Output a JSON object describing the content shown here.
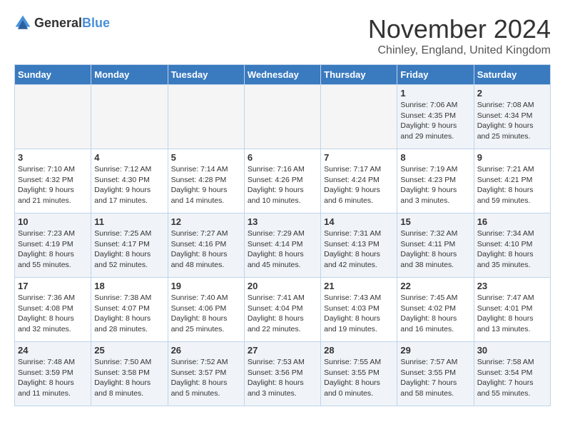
{
  "logo": {
    "text_general": "General",
    "text_blue": "Blue"
  },
  "header": {
    "month_year": "November 2024",
    "location": "Chinley, England, United Kingdom"
  },
  "weekdays": [
    "Sunday",
    "Monday",
    "Tuesday",
    "Wednesday",
    "Thursday",
    "Friday",
    "Saturday"
  ],
  "weeks": [
    [
      {
        "day": "",
        "info": "",
        "empty": true
      },
      {
        "day": "",
        "info": "",
        "empty": true
      },
      {
        "day": "",
        "info": "",
        "empty": true
      },
      {
        "day": "",
        "info": "",
        "empty": true
      },
      {
        "day": "",
        "info": "",
        "empty": true
      },
      {
        "day": "1",
        "info": "Sunrise: 7:06 AM\nSunset: 4:35 PM\nDaylight: 9 hours and 29 minutes.",
        "empty": false
      },
      {
        "day": "2",
        "info": "Sunrise: 7:08 AM\nSunset: 4:34 PM\nDaylight: 9 hours and 25 minutes.",
        "empty": false
      }
    ],
    [
      {
        "day": "3",
        "info": "Sunrise: 7:10 AM\nSunset: 4:32 PM\nDaylight: 9 hours and 21 minutes.",
        "empty": false
      },
      {
        "day": "4",
        "info": "Sunrise: 7:12 AM\nSunset: 4:30 PM\nDaylight: 9 hours and 17 minutes.",
        "empty": false
      },
      {
        "day": "5",
        "info": "Sunrise: 7:14 AM\nSunset: 4:28 PM\nDaylight: 9 hours and 14 minutes.",
        "empty": false
      },
      {
        "day": "6",
        "info": "Sunrise: 7:16 AM\nSunset: 4:26 PM\nDaylight: 9 hours and 10 minutes.",
        "empty": false
      },
      {
        "day": "7",
        "info": "Sunrise: 7:17 AM\nSunset: 4:24 PM\nDaylight: 9 hours and 6 minutes.",
        "empty": false
      },
      {
        "day": "8",
        "info": "Sunrise: 7:19 AM\nSunset: 4:23 PM\nDaylight: 9 hours and 3 minutes.",
        "empty": false
      },
      {
        "day": "9",
        "info": "Sunrise: 7:21 AM\nSunset: 4:21 PM\nDaylight: 8 hours and 59 minutes.",
        "empty": false
      }
    ],
    [
      {
        "day": "10",
        "info": "Sunrise: 7:23 AM\nSunset: 4:19 PM\nDaylight: 8 hours and 55 minutes.",
        "empty": false
      },
      {
        "day": "11",
        "info": "Sunrise: 7:25 AM\nSunset: 4:17 PM\nDaylight: 8 hours and 52 minutes.",
        "empty": false
      },
      {
        "day": "12",
        "info": "Sunrise: 7:27 AM\nSunset: 4:16 PM\nDaylight: 8 hours and 48 minutes.",
        "empty": false
      },
      {
        "day": "13",
        "info": "Sunrise: 7:29 AM\nSunset: 4:14 PM\nDaylight: 8 hours and 45 minutes.",
        "empty": false
      },
      {
        "day": "14",
        "info": "Sunrise: 7:31 AM\nSunset: 4:13 PM\nDaylight: 8 hours and 42 minutes.",
        "empty": false
      },
      {
        "day": "15",
        "info": "Sunrise: 7:32 AM\nSunset: 4:11 PM\nDaylight: 8 hours and 38 minutes.",
        "empty": false
      },
      {
        "day": "16",
        "info": "Sunrise: 7:34 AM\nSunset: 4:10 PM\nDaylight: 8 hours and 35 minutes.",
        "empty": false
      }
    ],
    [
      {
        "day": "17",
        "info": "Sunrise: 7:36 AM\nSunset: 4:08 PM\nDaylight: 8 hours and 32 minutes.",
        "empty": false
      },
      {
        "day": "18",
        "info": "Sunrise: 7:38 AM\nSunset: 4:07 PM\nDaylight: 8 hours and 28 minutes.",
        "empty": false
      },
      {
        "day": "19",
        "info": "Sunrise: 7:40 AM\nSunset: 4:06 PM\nDaylight: 8 hours and 25 minutes.",
        "empty": false
      },
      {
        "day": "20",
        "info": "Sunrise: 7:41 AM\nSunset: 4:04 PM\nDaylight: 8 hours and 22 minutes.",
        "empty": false
      },
      {
        "day": "21",
        "info": "Sunrise: 7:43 AM\nSunset: 4:03 PM\nDaylight: 8 hours and 19 minutes.",
        "empty": false
      },
      {
        "day": "22",
        "info": "Sunrise: 7:45 AM\nSunset: 4:02 PM\nDaylight: 8 hours and 16 minutes.",
        "empty": false
      },
      {
        "day": "23",
        "info": "Sunrise: 7:47 AM\nSunset: 4:01 PM\nDaylight: 8 hours and 13 minutes.",
        "empty": false
      }
    ],
    [
      {
        "day": "24",
        "info": "Sunrise: 7:48 AM\nSunset: 3:59 PM\nDaylight: 8 hours and 11 minutes.",
        "empty": false
      },
      {
        "day": "25",
        "info": "Sunrise: 7:50 AM\nSunset: 3:58 PM\nDaylight: 8 hours and 8 minutes.",
        "empty": false
      },
      {
        "day": "26",
        "info": "Sunrise: 7:52 AM\nSunset: 3:57 PM\nDaylight: 8 hours and 5 minutes.",
        "empty": false
      },
      {
        "day": "27",
        "info": "Sunrise: 7:53 AM\nSunset: 3:56 PM\nDaylight: 8 hours and 3 minutes.",
        "empty": false
      },
      {
        "day": "28",
        "info": "Sunrise: 7:55 AM\nSunset: 3:55 PM\nDaylight: 8 hours and 0 minutes.",
        "empty": false
      },
      {
        "day": "29",
        "info": "Sunrise: 7:57 AM\nSunset: 3:55 PM\nDaylight: 7 hours and 58 minutes.",
        "empty": false
      },
      {
        "day": "30",
        "info": "Sunrise: 7:58 AM\nSunset: 3:54 PM\nDaylight: 7 hours and 55 minutes.",
        "empty": false
      }
    ]
  ]
}
